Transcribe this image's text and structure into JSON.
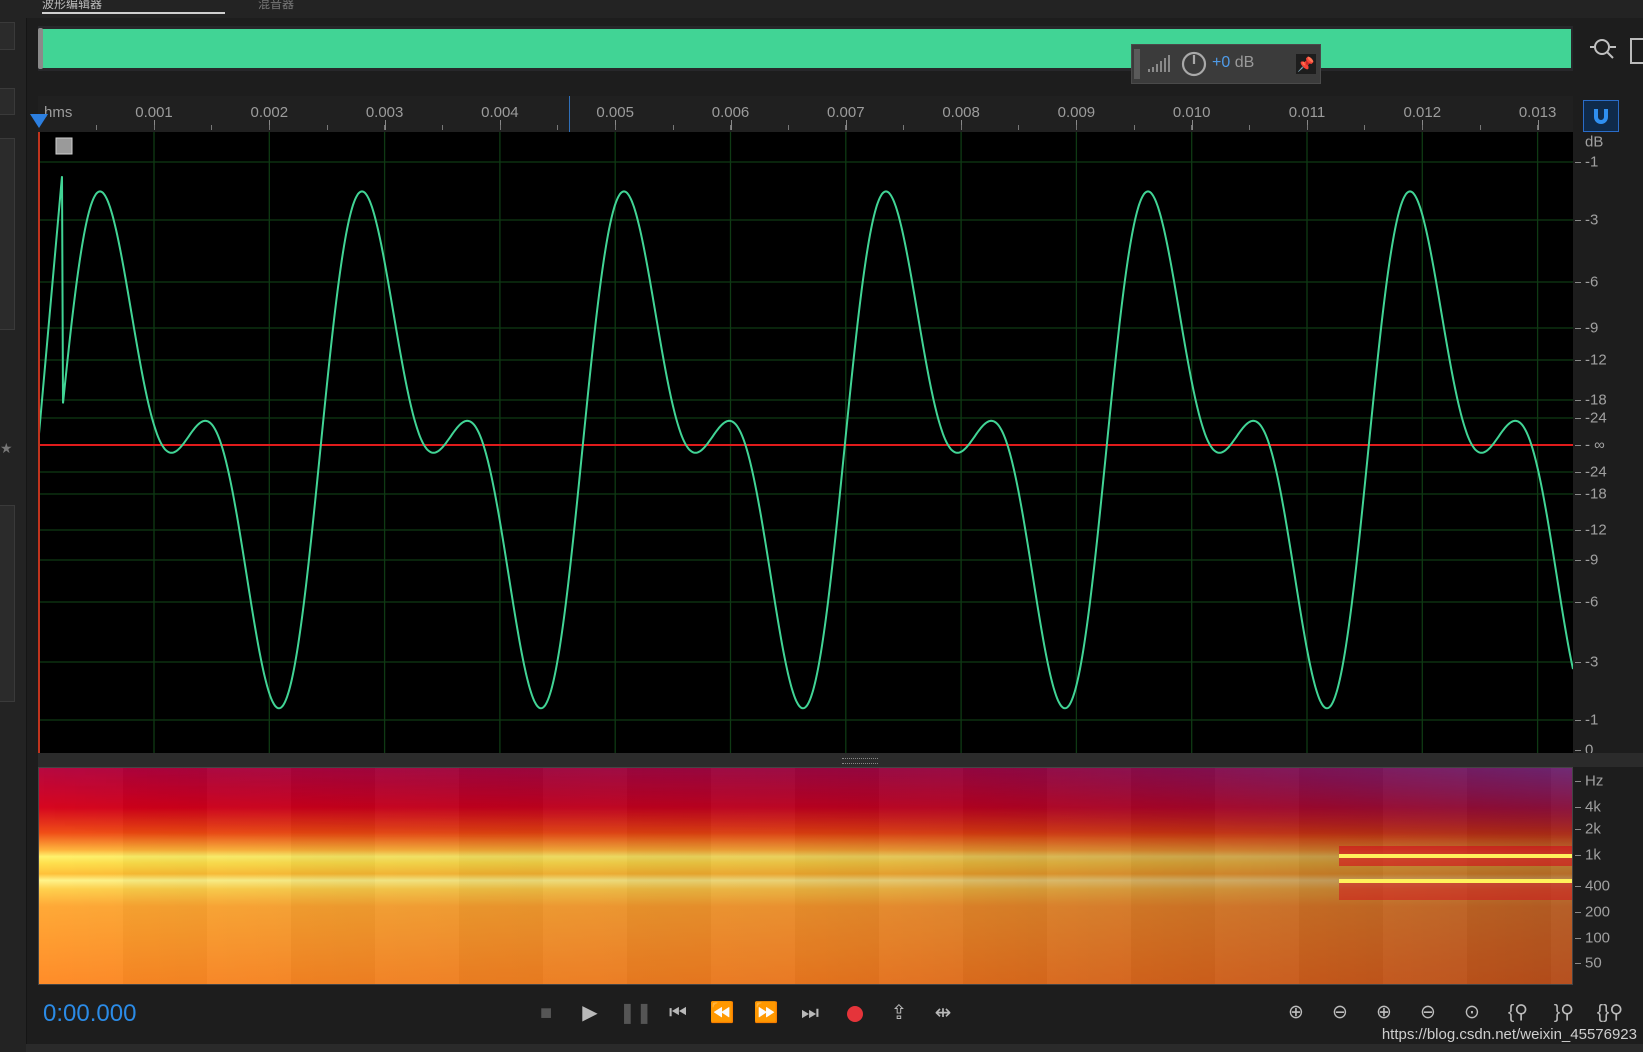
{
  "tabs": {
    "active": "波形编辑器",
    "mixer": "混音器"
  },
  "overview": {
    "hud_db_value": "+0",
    "hud_db_unit": " dB",
    "wave_color": "#41d495"
  },
  "ruler": {
    "unit": "hms",
    "ticks": [
      "0.001",
      "0.002",
      "0.003",
      "0.004",
      "0.005",
      "0.006",
      "0.007",
      "0.008",
      "0.009",
      "0.010",
      "0.011",
      "0.012",
      "0.013"
    ]
  },
  "waveform": {
    "line_color": "#41d495",
    "center_line_color": "#e01b1b",
    "db_scale": [
      "dB",
      "-1",
      "-3",
      "-6",
      "-9",
      "-12",
      "-18",
      "-24",
      "- ∞",
      "-24",
      "-18",
      "-12",
      "-9",
      "-6",
      "-3",
      "-1",
      "0"
    ]
  },
  "spectrum": {
    "hz_scale": [
      "Hz",
      "4k",
      "2k",
      "1k",
      "400",
      "200",
      "100",
      "50"
    ]
  },
  "transport": {
    "time": "0:00.000",
    "buttons": [
      "stop-icon",
      "play-icon",
      "pause-icon",
      "skip-to-start-icon",
      "rewind-icon",
      "fast-forward-icon",
      "skip-to-end-icon",
      "record-icon",
      "loop-playback-icon",
      "skip-selection-icon"
    ]
  },
  "zoom": {
    "buttons": [
      "zoom-in-amplitude-icon",
      "zoom-out-amplitude-icon",
      "zoom-in-time-icon",
      "zoom-out-time-icon",
      "zoom-full-icon",
      "zoom-in-left-icon",
      "zoom-in-right-icon",
      "zoom-selection-icon"
    ]
  },
  "watermark": "https://blog.csdn.net/weixin_45576923"
}
